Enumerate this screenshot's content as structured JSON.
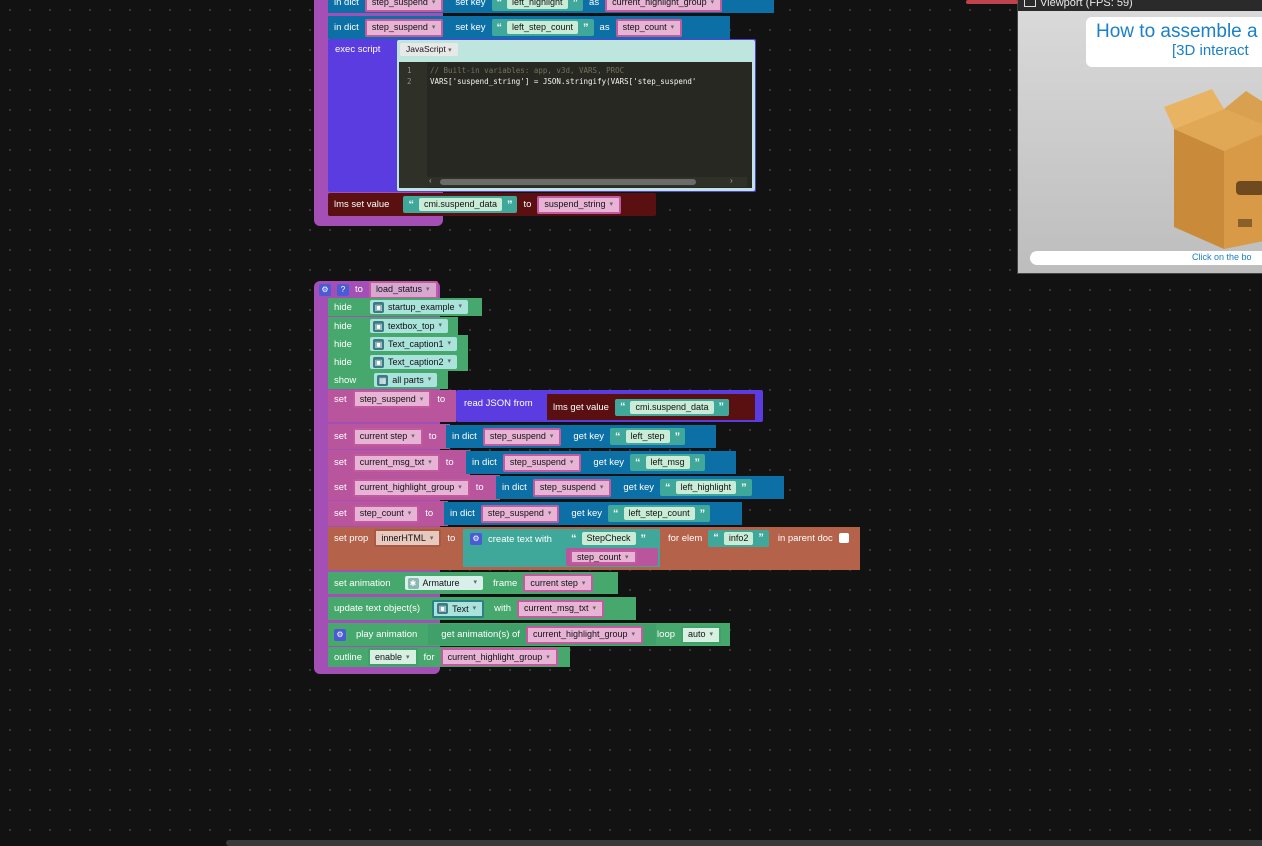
{
  "block_top": {
    "row1": {
      "label": "in dict",
      "dict": "step_suspend",
      "setkey": "set key",
      "key": "left_highlight",
      "as": "as",
      "var": "current_highlight_group"
    },
    "row2": {
      "label": "in dict",
      "dict": "step_suspend",
      "setkey": "set key",
      "key": "left_step_count",
      "as": "as",
      "var": "step_count"
    },
    "exec": {
      "label": "exec script",
      "lang": "JavaScript",
      "code_lines": [
        {
          "n": "1",
          "text": "// Built-in variables: app, v3d, VARS, PROC"
        },
        {
          "n": "2",
          "text": "VARS['suspend_string'] = JSON.stringify(VARS['step_suspend'"
        }
      ]
    },
    "lms": {
      "label": "lms set value",
      "key": "cmi.suspend_data",
      "to": "to",
      "var": "suspend_string"
    }
  },
  "block_load": {
    "header": {
      "to": "to",
      "name": "load_status"
    },
    "hides": [
      {
        "label": "hide",
        "obj": "startup_example"
      },
      {
        "label": "hide",
        "obj": "textbox_top"
      },
      {
        "label": "hide",
        "obj": "Text_caption1"
      },
      {
        "label": "hide",
        "obj": "Text_caption2"
      }
    ],
    "show": {
      "label": "show",
      "obj": "all parts"
    },
    "set_json": {
      "set": "set",
      "var": "step_suspend",
      "to": "to",
      "read": "read JSON from",
      "lms": "lms get value",
      "key": "cmi.suspend_data"
    },
    "sets": [
      {
        "set": "set",
        "var": "current step",
        "to": "to",
        "indict": "in dict",
        "dict": "step_suspend",
        "getkey": "get key",
        "key": "left_step"
      },
      {
        "set": "set",
        "var": "current_msg_txt",
        "to": "to",
        "indict": "in dict",
        "dict": "step_suspend",
        "getkey": "get key",
        "key": "left_msg"
      },
      {
        "set": "set",
        "var": "current_highlight_group",
        "to": "to",
        "indict": "in dict",
        "dict": "step_suspend",
        "getkey": "get key",
        "key": "left_highlight"
      },
      {
        "set": "set",
        "var": "step_count",
        "to": "to",
        "indict": "in dict",
        "dict": "step_suspend",
        "getkey": "get key",
        "key": "left_step_count"
      }
    ],
    "setprop": {
      "label": "set prop",
      "prop": "innerHTML",
      "to": "to",
      "create": "create text with",
      "str": "StepCheck",
      "var": "step_count",
      "forelem": "for elem",
      "elem": "info2",
      "parent": "in parent doc"
    },
    "setanim": {
      "label": "set animation",
      "obj": "Armature",
      "frame": "frame",
      "var": "current step"
    },
    "updtext": {
      "label": "update text object(s)",
      "obj": "Text",
      "with": "with",
      "var": "current_msg_txt"
    },
    "playanim": {
      "label": "play animation",
      "get": "get animation(s) of",
      "var": "current_highlight_group",
      "loop": "loop",
      "loopval": "auto"
    },
    "outline": {
      "label": "outline",
      "mode": "enable",
      "for": "for",
      "var": "current_highlight_group"
    }
  },
  "viewport": {
    "title": "Viewport (FPS: 59)",
    "heading1": "How to assemble a",
    "heading2": "[3D interact",
    "footer": "Click on the bo"
  },
  "colors": {
    "background": "#121212",
    "procedure": "#a44fb5",
    "dict": "#0c6fa6",
    "string": "#3fa89a",
    "variable": "#e8b4d6"
  }
}
